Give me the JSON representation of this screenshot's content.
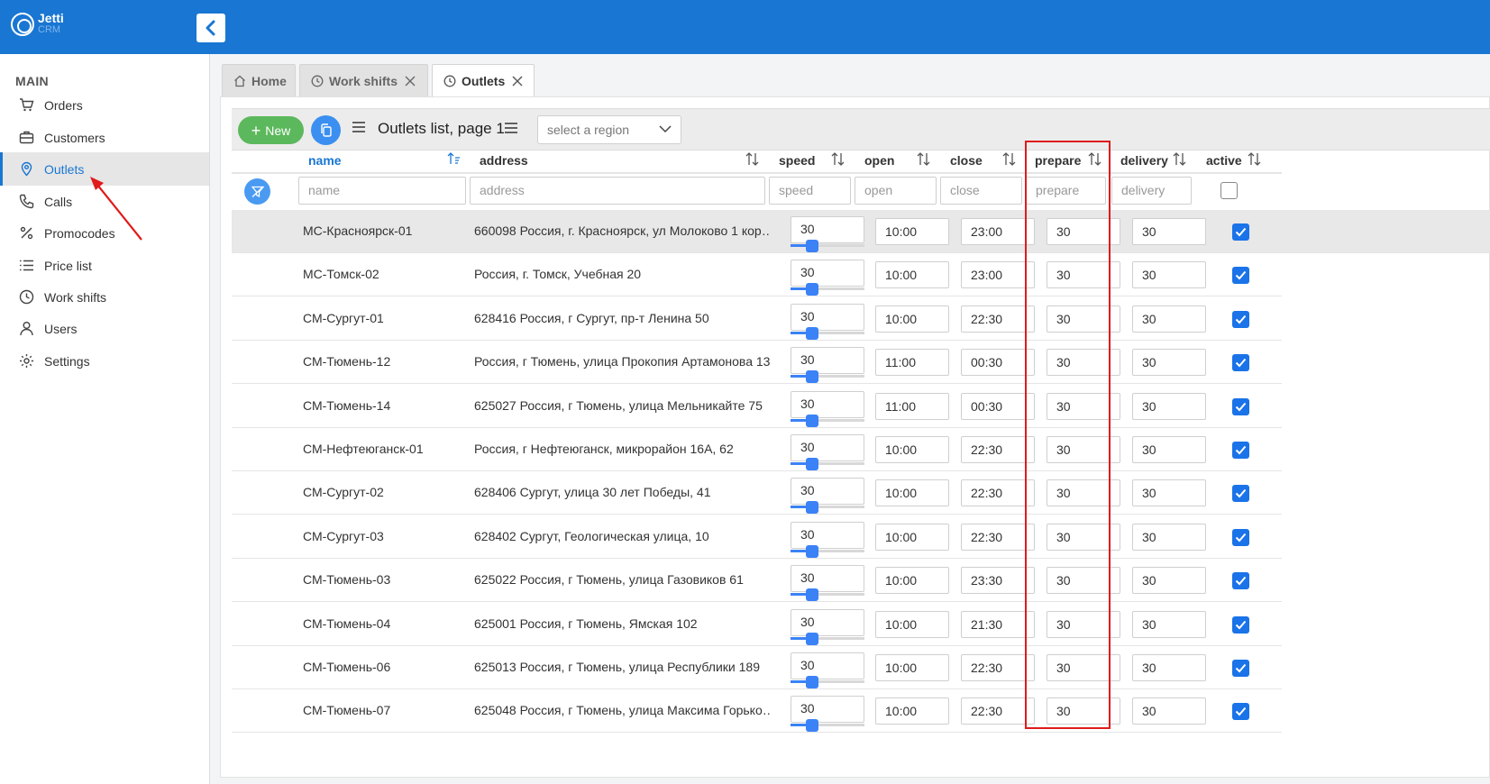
{
  "app": {
    "name": "Jetti",
    "sub": "CRM"
  },
  "sidebar": {
    "section": "MAIN",
    "items": [
      {
        "label": "Orders",
        "icon": "cart-icon"
      },
      {
        "label": "Customers",
        "icon": "briefcase-icon"
      },
      {
        "label": "Outlets",
        "icon": "map-pin-icon",
        "active": true
      },
      {
        "label": "Calls",
        "icon": "phone-icon"
      },
      {
        "label": "Promocodes",
        "icon": "percent-icon"
      },
      {
        "label": "Price list",
        "icon": "list-icon"
      },
      {
        "label": "Work shifts",
        "icon": "clock-icon"
      },
      {
        "label": "Users",
        "icon": "user-icon"
      },
      {
        "label": "Settings",
        "icon": "gear-icon"
      }
    ]
  },
  "tabs": [
    {
      "label": "Home",
      "icon": "home-icon",
      "closable": false
    },
    {
      "label": "Work shifts",
      "icon": "clock-icon",
      "closable": true
    },
    {
      "label": "Outlets",
      "icon": "clock-icon",
      "closable": true,
      "active": true
    }
  ],
  "toolbar": {
    "new_label": "New",
    "list_title": "Outlets list, page 1",
    "region_placeholder": "select a region"
  },
  "columns": {
    "name": "name",
    "address": "address",
    "speed": "speed",
    "open": "open",
    "close": "close",
    "prepare": "prepare",
    "delivery": "delivery",
    "active": "active"
  },
  "filters": {
    "name": "name",
    "address": "address",
    "speed": "speed",
    "open": "open",
    "close": "close",
    "prepare": "prepare",
    "delivery": "delivery"
  },
  "rows": [
    {
      "name": "МС-Красноярск-01",
      "address": "660098 Россия, г. Красноярск, ул Молоково 1 кор…",
      "speed": "30",
      "open": "10:00",
      "close": "23:00",
      "prepare": "30",
      "delivery": "30",
      "active": true
    },
    {
      "name": "МС-Томск-02",
      "address": "Россия, г. Томск, Учебная 20",
      "speed": "30",
      "open": "10:00",
      "close": "23:00",
      "prepare": "30",
      "delivery": "30",
      "active": true
    },
    {
      "name": "СМ-Сургут-01",
      "address": "628416 Россия, г Сургут, пр-т Ленина 50",
      "speed": "30",
      "open": "10:00",
      "close": "22:30",
      "prepare": "30",
      "delivery": "30",
      "active": true
    },
    {
      "name": "СМ-Тюмень-12",
      "address": "Россия, г Тюмень, улица Прокопия Артамонова 13",
      "speed": "30",
      "open": "11:00",
      "close": "00:30",
      "prepare": "30",
      "delivery": "30",
      "active": true
    },
    {
      "name": "СМ-Тюмень-14",
      "address": "625027 Россия, г Тюмень, улица Мельникайте 75",
      "speed": "30",
      "open": "11:00",
      "close": "00:30",
      "prepare": "30",
      "delivery": "30",
      "active": true
    },
    {
      "name": "СМ-Нефтеюганск-01",
      "address": "Россия, г Нефтеюганск, микрорайон 16А, 62",
      "speed": "30",
      "open": "10:00",
      "close": "22:30",
      "prepare": "30",
      "delivery": "30",
      "active": true
    },
    {
      "name": "СМ-Сургут-02",
      "address": "628406 Сургут, улица 30 лет Победы, 41",
      "speed": "30",
      "open": "10:00",
      "close": "22:30",
      "prepare": "30",
      "delivery": "30",
      "active": true
    },
    {
      "name": "СМ-Сургут-03",
      "address": "628402 Сургут, Геологическая улица, 10",
      "speed": "30",
      "open": "10:00",
      "close": "22:30",
      "prepare": "30",
      "delivery": "30",
      "active": true
    },
    {
      "name": "СМ-Тюмень-03",
      "address": "625022 Россия, г Тюмень, улица Газовиков 61",
      "speed": "30",
      "open": "10:00",
      "close": "23:30",
      "prepare": "30",
      "delivery": "30",
      "active": true
    },
    {
      "name": "СМ-Тюмень-04",
      "address": "625001 Россия, г Тюмень, Ямская 102",
      "speed": "30",
      "open": "10:00",
      "close": "21:30",
      "prepare": "30",
      "delivery": "30",
      "active": true
    },
    {
      "name": "СМ-Тюмень-06",
      "address": "625013 Россия, г Тюмень, улица Республики 189",
      "speed": "30",
      "open": "10:00",
      "close": "22:30",
      "prepare": "30",
      "delivery": "30",
      "active": true
    },
    {
      "name": "СМ-Тюмень-07",
      "address": "625048 Россия, г Тюмень, улица Максима Горько…",
      "speed": "30",
      "open": "10:00",
      "close": "22:30",
      "prepare": "30",
      "delivery": "30",
      "active": true
    }
  ],
  "colors": {
    "brand": "#1976d2",
    "new_button": "#5cb85c",
    "checkbox": "#1a73e8",
    "highlight": "#e01b1b",
    "annotation_arrow": "#e01b1b"
  }
}
